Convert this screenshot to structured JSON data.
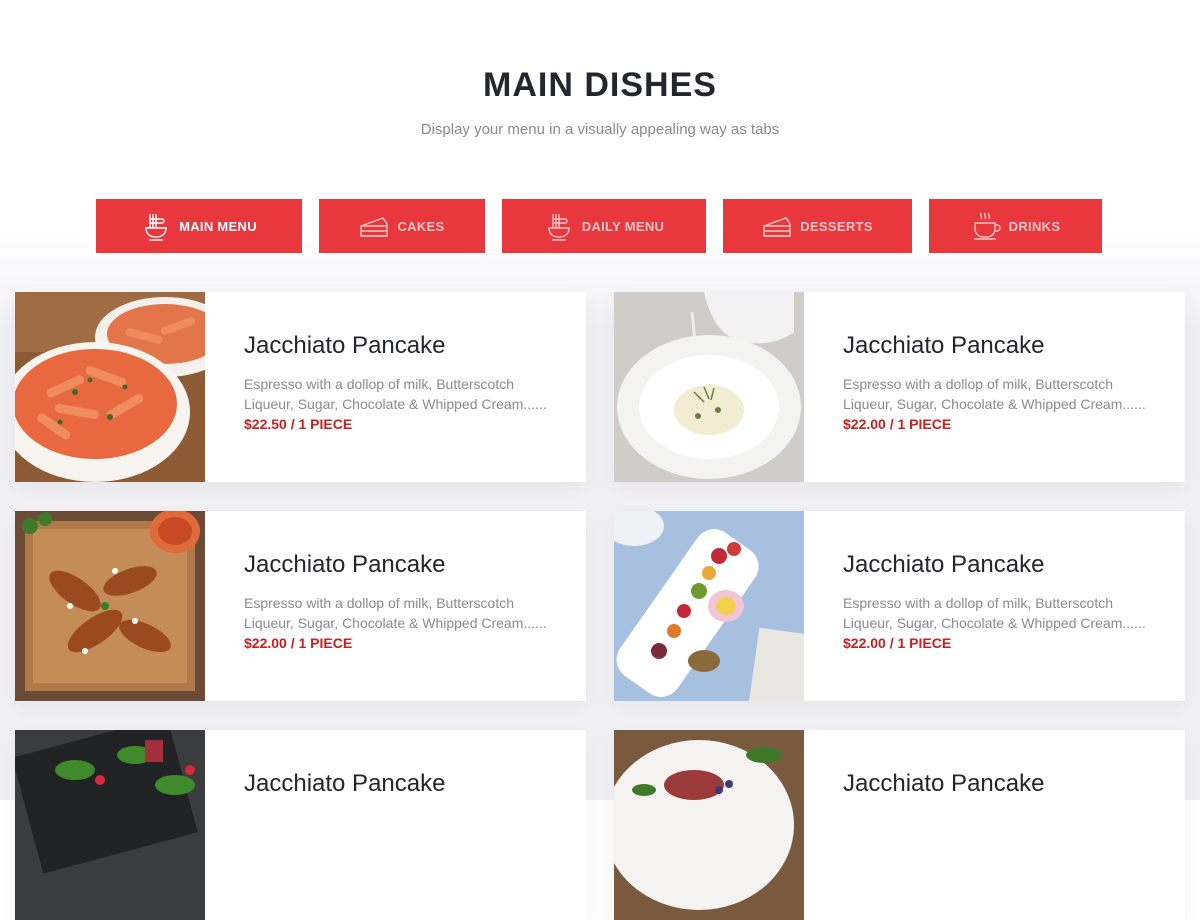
{
  "header": {
    "title": "MAIN DISHES",
    "subtitle": "Display your menu in a visually appealing way as tabs"
  },
  "tabs": [
    {
      "label": "MAIN MENU",
      "icon": "noodles-icon",
      "active": true
    },
    {
      "label": "CAKES",
      "icon": "cake-icon",
      "active": false
    },
    {
      "label": "DAILY MENU",
      "icon": "noodles-icon",
      "active": false
    },
    {
      "label": "DESSERTS",
      "icon": "cake-icon",
      "active": false
    },
    {
      "label": "DRINKS",
      "icon": "coffee-cup-icon",
      "active": false
    }
  ],
  "colors": {
    "accent": "#e8383d",
    "price": "#c8201f",
    "heading": "#24252e",
    "muted": "#8a8a8f"
  },
  "menu_items": [
    {
      "name": "Jacchiato Pancake",
      "desc": "Espresso with a dollop of milk, Butterscotch Liqueur, Sugar, Chocolate & Whipped Cream......",
      "price": "$22.50 / 1 PIECE",
      "photo": "penne-pasta-photo"
    },
    {
      "name": "Jacchiato Pancake",
      "desc": "Espresso with a dollop of milk, Butterscotch Liqueur, Sugar, Chocolate & Whipped Cream......",
      "price": "$22.00 / 1 PIECE",
      "photo": "sauce-pouring-dish-photo"
    },
    {
      "name": "Jacchiato Pancake",
      "desc": "Espresso with a dollop of milk, Butterscotch Liqueur, Sugar, Chocolate & Whipped Cream......",
      "price": "$22.00 / 1 PIECE",
      "photo": "chicken-wings-photo"
    },
    {
      "name": "Jacchiato Pancake",
      "desc": "Espresso with a dollop of milk, Butterscotch Liqueur, Sugar, Chocolate & Whipped Cream......",
      "price": "$22.00 / 1 PIECE",
      "photo": "fruit-platter-photo"
    },
    {
      "name": "Jacchiato Pancake",
      "desc": "",
      "price": "",
      "photo": "salad-photo"
    },
    {
      "name": "Jacchiato Pancake",
      "desc": "",
      "price": "",
      "photo": "steak-plate-photo"
    }
  ]
}
